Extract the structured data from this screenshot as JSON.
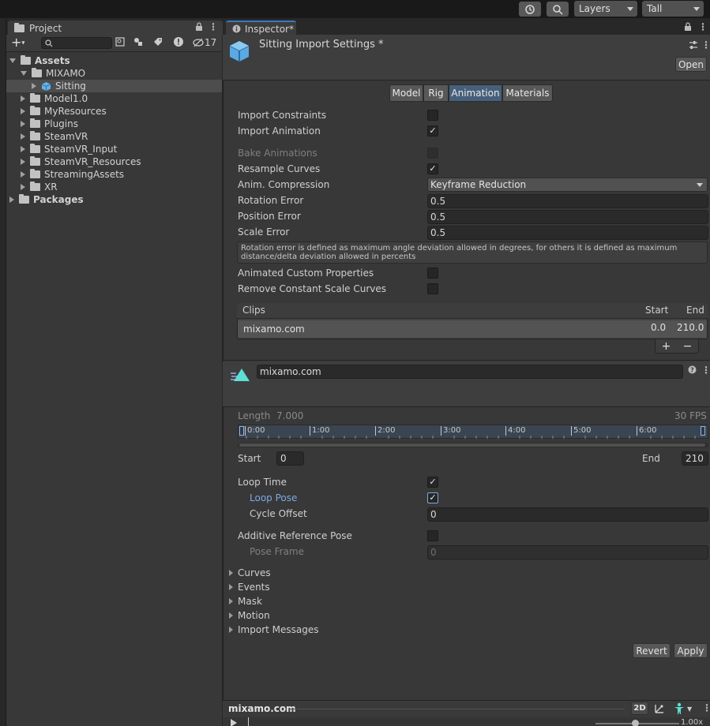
{
  "toolbar": {
    "layers_label": "Layers",
    "layout_label": "Tall"
  },
  "project": {
    "tab_label": "Project",
    "hidden_count": "17",
    "tree": [
      {
        "label": "Assets",
        "level": 0,
        "open": true,
        "bold": true
      },
      {
        "label": "MIXAMO",
        "level": 1,
        "open": true
      },
      {
        "label": "Sitting",
        "level": 2,
        "open": false,
        "selected": true,
        "asset": true
      },
      {
        "label": "Model1.0",
        "level": 1
      },
      {
        "label": "MyResources",
        "level": 1
      },
      {
        "label": "Plugins",
        "level": 1
      },
      {
        "label": "SteamVR",
        "level": 1
      },
      {
        "label": "SteamVR_Input",
        "level": 1
      },
      {
        "label": "SteamVR_Resources",
        "level": 1
      },
      {
        "label": "StreamingAssets",
        "level": 1
      },
      {
        "label": "XR",
        "level": 1
      },
      {
        "label": "Packages",
        "level": 0,
        "bold": true
      }
    ]
  },
  "inspector": {
    "tab_label": "Inspector*",
    "title": "Sitting Import Settings *",
    "open_button": "Open",
    "tabs": [
      "Model",
      "Rig",
      "Animation",
      "Materials"
    ],
    "active_tab": "Animation",
    "import_constraints": "Import Constraints",
    "import_animation": "Import Animation",
    "bake_animations": "Bake Animations",
    "resample_curves": "Resample Curves",
    "anim_compression": "Anim. Compression",
    "anim_compression_value": "Keyframe Reduction",
    "rotation_error": "Rotation Error",
    "rotation_error_value": "0.5",
    "position_error": "Position Error",
    "position_error_value": "0.5",
    "scale_error": "Scale Error",
    "scale_error_value": "0.5",
    "help_text": "Rotation error is defined as maximum angle deviation allowed in degrees, for others it is defined as maximum distance/delta deviation allowed in percents",
    "animated_custom_properties": "Animated Custom Properties",
    "remove_constant_scale_curves": "Remove Constant Scale Curves",
    "clips": {
      "header": "Clips",
      "start_header": "Start",
      "end_header": "End",
      "rows": [
        {
          "name": "mixamo.com",
          "start": "0.0",
          "end": "210.0"
        }
      ],
      "add": "+",
      "remove": "−"
    },
    "clip": {
      "name": "mixamo.com",
      "length_label": "Length",
      "length_value": "7.000",
      "fps": "30 FPS",
      "ticks": [
        "0:00",
        "1:00",
        "2:00",
        "3:00",
        "4:00",
        "5:00",
        "6:00"
      ],
      "start_label": "Start",
      "start_value": "0",
      "end_label": "End",
      "end_value": "210",
      "loop_time": "Loop Time",
      "loop_pose": "Loop Pose",
      "cycle_offset": "Cycle Offset",
      "cycle_offset_value": "0",
      "additive_reference_pose": "Additive Reference Pose",
      "pose_frame": "Pose Frame",
      "pose_frame_value": "0"
    },
    "foldouts": [
      "Curves",
      "Events",
      "Mask",
      "Motion",
      "Import Messages"
    ],
    "revert_button": "Revert",
    "apply_button": "Apply",
    "preview": {
      "name": "mixamo.com",
      "mode_2d": "2D",
      "speed": "1.00x"
    }
  },
  "colors": {
    "accent": "#3a79bb",
    "active_tab": "#46607c",
    "link_label": "#7ba9e6",
    "clip_icon": "#5de0d5"
  }
}
